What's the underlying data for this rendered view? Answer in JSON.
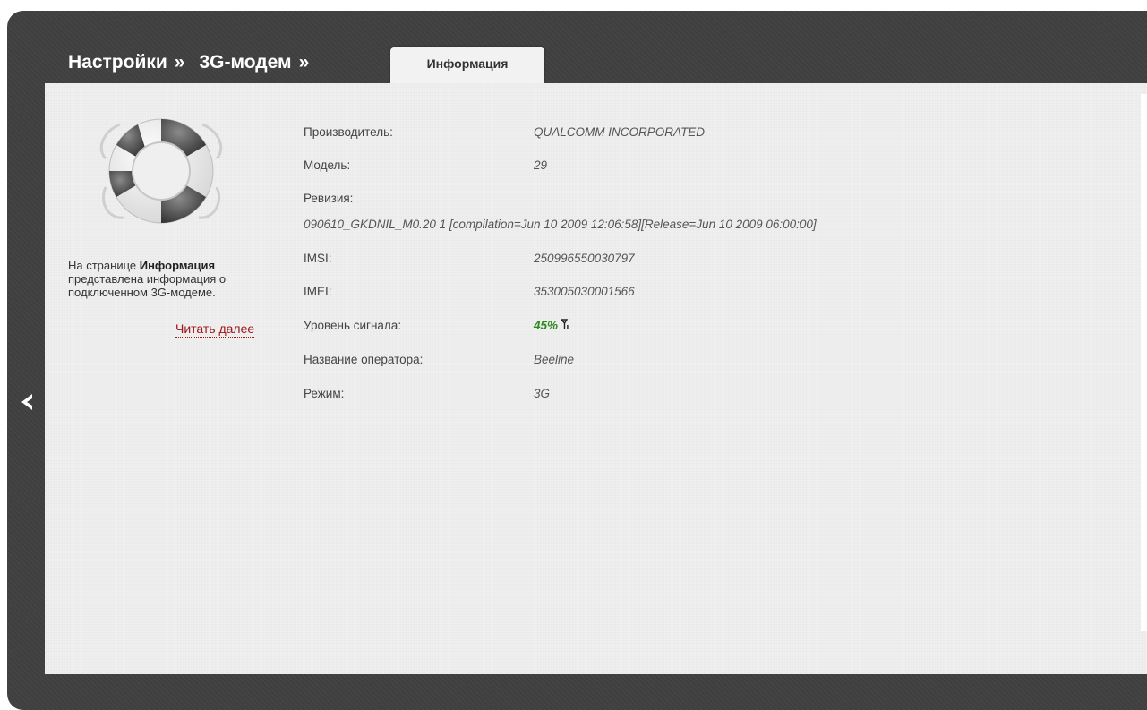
{
  "breadcrumb": {
    "items": [
      {
        "label": "Настройки",
        "sep": "»"
      },
      {
        "label": "3G-модем",
        "sep": "»"
      }
    ]
  },
  "tab": {
    "label": "Информация"
  },
  "help": {
    "prefix": "На странице ",
    "bold": "Информация",
    "suffix": " представлена информация о подключенном 3G-модеме.",
    "read_more": "Читать далее"
  },
  "info": {
    "manufacturer": {
      "label": "Производитель:",
      "value": "QUALCOMM INCORPORATED"
    },
    "model": {
      "label": "Модель:",
      "value": "29"
    },
    "revision": {
      "label": "Ревизия:",
      "value": "090610_GKDNIL_M0.20 1 [compilation=Jun 10 2009 12:06:58][Release=Jun 10 2009 06:00:00]"
    },
    "imsi": {
      "label": "IMSI:",
      "value": "250996550030797"
    },
    "imei": {
      "label": "IMEI:",
      "value": "353005030001566"
    },
    "signal": {
      "label": "Уровень сигнала:",
      "value": "45%",
      "icon": "antenna-icon",
      "color": "#2c8a1e"
    },
    "operator": {
      "label": "Название оператора:",
      "value": "Beeline"
    },
    "mode": {
      "label": "Режим:",
      "value": "3G"
    }
  },
  "colors": {
    "frame": "#404040",
    "panel": "#efefef",
    "link_red": "#a0151b",
    "signal_green": "#2c8a1e"
  }
}
